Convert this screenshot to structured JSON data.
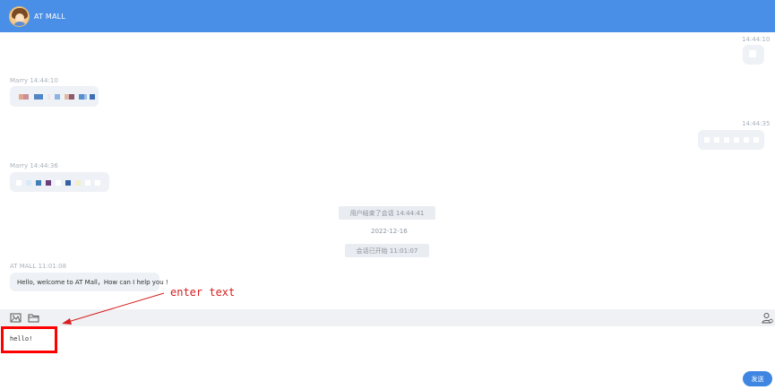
{
  "header": {
    "title": "AT MALL"
  },
  "messages": [
    {
      "side": "right",
      "time": "14:44:10"
    },
    {
      "side": "left",
      "sender": "Marry",
      "time": "14:44:10",
      "label": "Marry 14:44:10"
    },
    {
      "side": "right",
      "time": "14:44:35"
    },
    {
      "side": "left",
      "sender": "Marry",
      "time": "14:44:36",
      "label": "Marry 14:44:36"
    },
    {
      "side": "left",
      "sender": "AT MALL",
      "time": "11:01:08",
      "label": "AT MALL 11:01:08",
      "text": "Hello, welcome to AT Mall，How can I help you !"
    }
  ],
  "system": {
    "session_end": "用户结束了会话 14:44:41",
    "date": "2022-12-16",
    "session_start": "会话已开始 11:01:07"
  },
  "toolbar": {
    "icons": [
      "image-icon",
      "folder-icon",
      "transfer-agent-icon"
    ]
  },
  "input": {
    "value": "hello!"
  },
  "annotation": {
    "text": "enter text",
    "color": "#d61f1f"
  },
  "send_button": {
    "label": "发送"
  },
  "colors": {
    "header": "#4a8fe7",
    "bubble": "#eef1f5",
    "send": "#3f86e2",
    "highlight": "#ff0000"
  }
}
